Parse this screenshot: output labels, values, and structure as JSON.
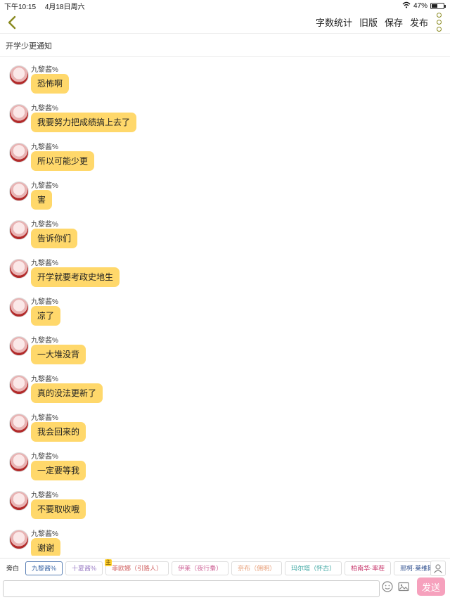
{
  "status": {
    "time": "下午10:15",
    "date": "4月18日周六",
    "battery": "47%",
    "battery_level": 0.47
  },
  "nav": {
    "word_count": "字数统计",
    "old_version": "旧版",
    "save": "保存",
    "publish": "发布"
  },
  "title": "开学少更通知",
  "messages": [
    {
      "sender": "九黎酱%",
      "text": "恐怖啊"
    },
    {
      "sender": "九黎酱%",
      "text": "我要努力把成绩搞上去了"
    },
    {
      "sender": "九黎酱%",
      "text": "所以可能少更"
    },
    {
      "sender": "九黎酱%",
      "text": "害"
    },
    {
      "sender": "九黎酱%",
      "text": "告诉你们"
    },
    {
      "sender": "九黎酱%",
      "text": "开学就要考政史地生"
    },
    {
      "sender": "九黎酱%",
      "text": "凉了"
    },
    {
      "sender": "九黎酱%",
      "text": "一大堆没背"
    },
    {
      "sender": "九黎酱%",
      "text": "真的没法更新了"
    },
    {
      "sender": "九黎酱%",
      "text": "我会回来的"
    },
    {
      "sender": "九黎酱%",
      "text": "一定要等我"
    },
    {
      "sender": "九黎酱%",
      "text": "不要取收哦"
    },
    {
      "sender": "九黎酱%",
      "text": "谢谢"
    }
  ],
  "roles": [
    {
      "label": "旁白",
      "color": "#222222",
      "type": "narr"
    },
    {
      "label": "九黎酱%",
      "color": "#3b66a6",
      "type": "active"
    },
    {
      "label": "十夏酱%",
      "color": "#9b7dc5",
      "type": ""
    },
    {
      "label": "菲欧娜（引路人）",
      "color": "#d36a6a",
      "type": "owner",
      "badge": "主"
    },
    {
      "label": "伊莱（夜行梟）",
      "color": "#d06a9b",
      "type": ""
    },
    {
      "label": "奈布（佣明）",
      "color": "#e8a07a",
      "type": ""
    },
    {
      "label": "玛尔塔（怀古）",
      "color": "#3aa5a0",
      "type": ""
    },
    {
      "label": "柏南华·率茬",
      "color": "#c7356a",
      "type": ""
    },
    {
      "label": "邢柯·莱维斯",
      "color": "#2f4f8e",
      "type": ""
    }
  ],
  "input": {
    "placeholder": "",
    "send": "发送"
  }
}
